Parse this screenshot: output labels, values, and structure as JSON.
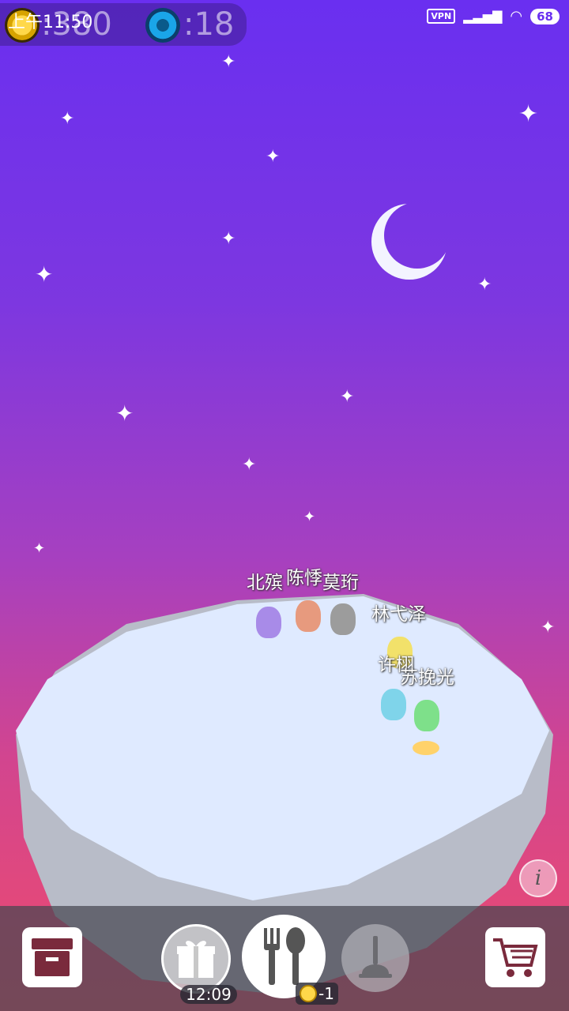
{
  "status_bar": {
    "time": "上午11:50",
    "vpn": "VPN",
    "battery": "68"
  },
  "hud": {
    "coins": ":380",
    "gems": ":18"
  },
  "players": [
    {
      "name": "北殡",
      "color": "#a88be8"
    },
    {
      "name": "陈悸",
      "color": "#e79a7e"
    },
    {
      "name": "莫珩",
      "color": "#9c9c9c"
    },
    {
      "name": "林弋泽",
      "color": "#f2e16a"
    },
    {
      "name": "许栩",
      "color": "#7fd4ea"
    },
    {
      "name": "苏挽光",
      "color": "#7ee08a"
    }
  ],
  "toolbar": {
    "gift_timer": "12:09",
    "feed_cost": "-1",
    "info_label": "i"
  },
  "colors": {
    "sky_top": "#6a2ff0",
    "sky_bottom": "#ee4b6d",
    "island_top": "#dfeaff",
    "island_side": "#b8bcc8"
  }
}
